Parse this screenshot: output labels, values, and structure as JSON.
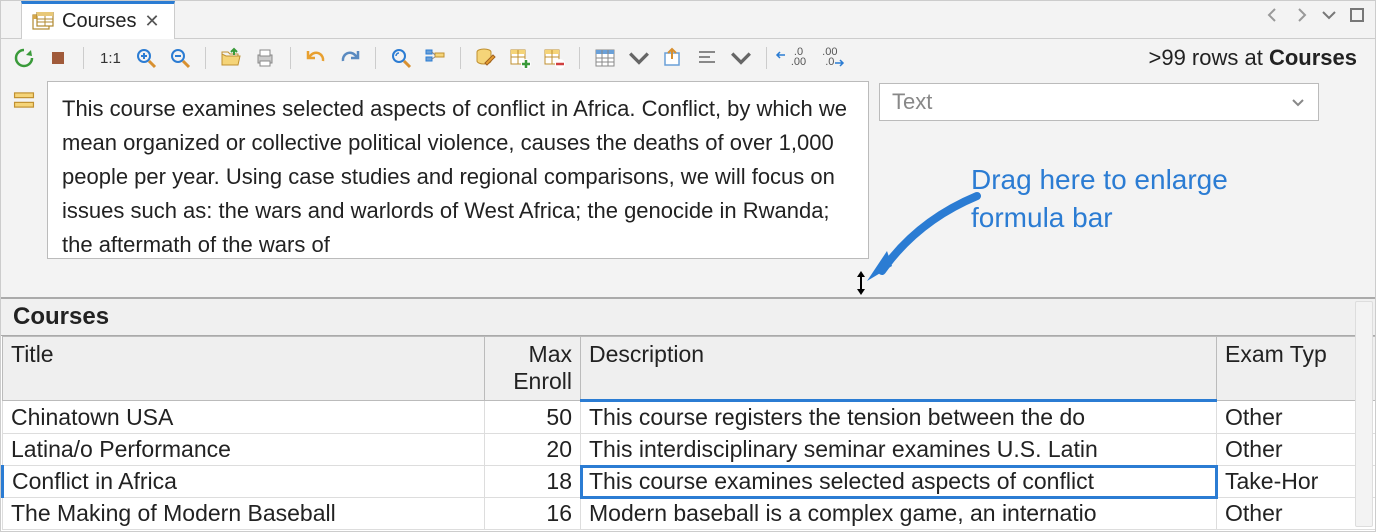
{
  "tab": {
    "title": "Courses"
  },
  "status": {
    "prefix": ">99 rows at ",
    "table": "Courses"
  },
  "toolbar": {
    "ratio": "1:1",
    "dec_left": ".0",
    "dec_left_sub": ".00",
    "dec_right": ".00",
    "dec_right_sub": ".0"
  },
  "formula": {
    "text": "This course examines selected aspects of conflict in Africa. Conflict, by which we mean organized or collective political violence, causes the deaths of over 1,000 people per year. Using case studies and regional comparisons, we will focus on issues such as: the wars and warlords of West Africa; the genocide in Rwanda; the aftermath of the wars of",
    "type_placeholder": "Text"
  },
  "annotation": {
    "line1": "Drag here to enlarge",
    "line2": "formula bar"
  },
  "grid": {
    "title": "Courses",
    "columns": {
      "title": "Title",
      "max_enroll_l1": "Max",
      "max_enroll_l2": "Enroll",
      "description": "Description",
      "exam_type": "Exam Typ"
    },
    "rows": [
      {
        "title": "Chinatown USA",
        "max_enroll": "50",
        "description": "This course registers the tension between the do",
        "exam": "Other"
      },
      {
        "title": "Latina/o Performance",
        "max_enroll": "20",
        "description": "This interdisciplinary seminar examines U.S. Latin",
        "exam": "Other"
      },
      {
        "title": "Conflict in Africa",
        "max_enroll": "18",
        "description": "This course examines selected aspects of conflict",
        "exam": "Take-Hor"
      },
      {
        "title": "The Making of Modern Baseball",
        "max_enroll": "16",
        "description": "Modern baseball is a complex game, an internatio",
        "exam": "Other"
      }
    ]
  }
}
